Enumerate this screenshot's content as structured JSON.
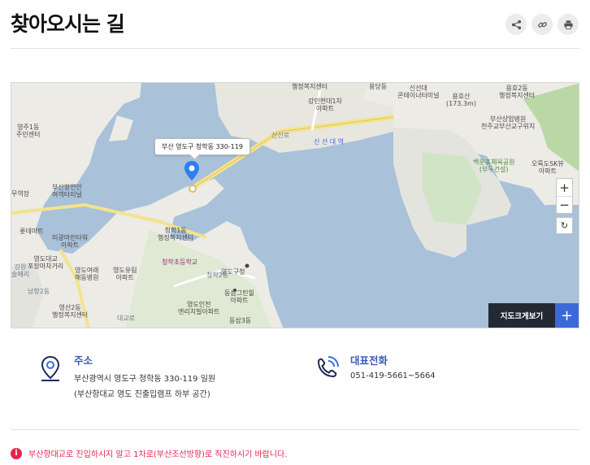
{
  "page": {
    "title": "찾아오시는 길"
  },
  "share": [
    {
      "name": "share-icon"
    },
    {
      "name": "link-icon"
    },
    {
      "name": "print-icon"
    }
  ],
  "map": {
    "bubble": "부산 영도구 청학동 330-119",
    "labels": [
      "행정복지센터",
      "신선대\n콘테이너터미널",
      "용호2동\n행정복지센터",
      "용당동",
      "강민현대1차\n아파트",
      "부산상업병원\n천주교부산교구위치",
      "용호산\n(173.3m)",
      "영주1동\n주민센터",
      "신 선 대 역",
      "부산항연안\n여객터미널",
      "무역장",
      "백운포체육공원\n(부두건설)",
      "오륙도SK뷰\n아파트",
      "청학1동\n행정복지센터",
      "미광마린타워\n아파트",
      "롯데마트",
      "영도대교\n포장마차거리",
      "청학초등학교",
      "영도여래\n해동병원",
      "영도유림\n아파트",
      "영도구청",
      "동삼그린힐\n아파트",
      "영선2동\n행정복지센터",
      "영도인천\n엔리치빌아파트",
      "동삼3동",
      "남항2동",
      "청학2동",
      "신선로",
      "강원\n슬메리",
      "대교로"
    ],
    "zoom_in": "+",
    "zoom_out": "−",
    "refresh": "↻",
    "bigmap_label": "지도크게보기",
    "bigmap_plus": "+",
    "provider": "kakao"
  },
  "address": {
    "heading": "주소",
    "line1": "부산광역시 영도구 청학동 330-119 일원",
    "line2": "(부산항대교 영도 진출입램프 하부 공간)"
  },
  "phone": {
    "heading": "대표전화",
    "number": "051-419-5661~5664"
  },
  "notice": {
    "badge": "i",
    "text": "부산항대교로 진입하시지 말고 1차로(부산조선방향)로 직진하시기 바랍니다."
  }
}
